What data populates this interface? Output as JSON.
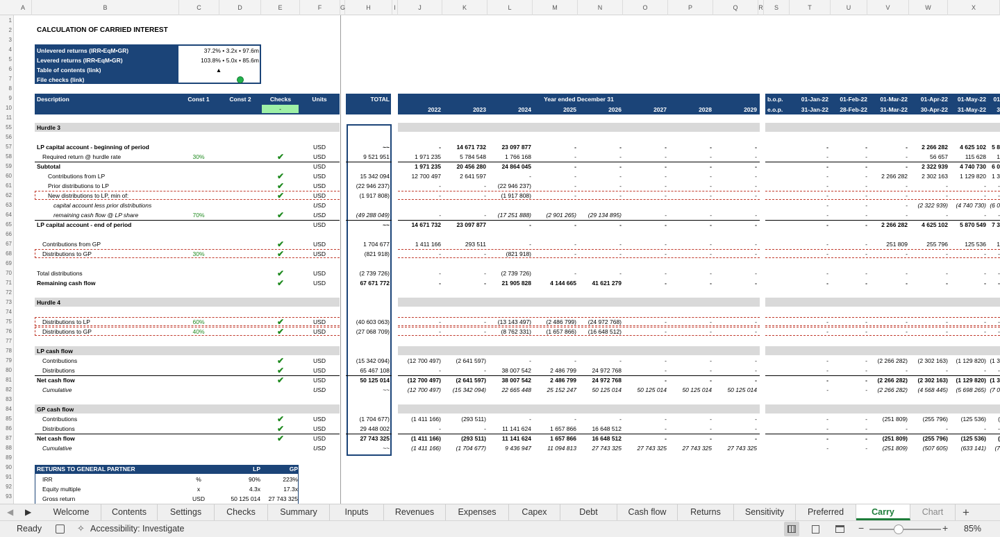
{
  "columns": [
    "A",
    "B",
    "C",
    "D",
    "E",
    "F",
    "G",
    "H",
    "I",
    "J",
    "K",
    "L",
    "M",
    "N",
    "O",
    "P",
    "Q",
    "R",
    "S",
    "T",
    "U",
    "V",
    "W",
    "X"
  ],
  "rows": [
    "1",
    "2",
    "3",
    "4",
    "5",
    "6",
    "7",
    "8",
    "9",
    "10",
    "11",
    "55",
    "56",
    "57",
    "58",
    "59",
    "60",
    "61",
    "62",
    "63",
    "64",
    "65",
    "66",
    "67",
    "68",
    "69",
    "70",
    "71",
    "72",
    "73",
    "74",
    "75",
    "76",
    "77",
    "78",
    "79",
    "80",
    "81",
    "82",
    "83",
    "84",
    "85",
    "86",
    "87",
    "88",
    "89",
    "90",
    "91",
    "92",
    "93"
  ],
  "title": "CALCULATION OF CARRIED INTEREST",
  "summary": {
    "unlevered_label": "Unlevered returns (IRR•EqM•GR)",
    "unlevered_value": "37.2% • 3.2x • 97.6m",
    "levered_label": "Levered returns (IRR•EqM•GR)",
    "levered_value": "103.8% • 5.0x • 85.6m",
    "toc_label": "Table of contents (link)",
    "toc_icon": "▲",
    "checks_label": "File checks (link)"
  },
  "header": {
    "description": "Description",
    "const1": "Const 1",
    "const2": "Const 2",
    "checks": "Checks",
    "checks_value": "-",
    "units": "Units",
    "total": "TOTAL",
    "year_ended": "Year ended December 31",
    "years": [
      "2022",
      "2023",
      "2024",
      "2025",
      "2026",
      "2027",
      "2028",
      "2029"
    ],
    "bop": "b.o.p.",
    "eop": "e.o.p.",
    "months_bop": [
      "01-Jan-22",
      "01-Feb-22",
      "01-Mar-22",
      "01-Apr-22",
      "01-May-22",
      "01"
    ],
    "months_eop": [
      "31-Jan-22",
      "28-Feb-22",
      "31-Mar-22",
      "30-Apr-22",
      "31-May-22",
      "3"
    ]
  },
  "table_rows": [
    {
      "row": "57",
      "label": "LP capital account - beginning of period",
      "bold": true,
      "check": false,
      "units": "USD",
      "total": "~~",
      "years": [
        "-",
        "14 671 732",
        "23 097 877",
        "-",
        "-",
        "-",
        "-",
        "-"
      ],
      "months": [
        "-",
        "-",
        "-",
        "2 266 282",
        "4 625 102",
        "5 8"
      ]
    },
    {
      "row": "58",
      "label": "Required return @ hurdle rate",
      "indent": 1,
      "const1": "30%",
      "check": true,
      "units": "USD",
      "total": "9 521 951",
      "years": [
        "1 971 235",
        "5 784 548",
        "1 766 168",
        "-",
        "-",
        "-",
        "-",
        "-"
      ],
      "months": [
        "-",
        "-",
        "-",
        "56 657",
        "115 628",
        "1"
      ]
    },
    {
      "row": "59",
      "label": "Subtotal",
      "bold": true,
      "units": "USD",
      "total": "",
      "years": [
        "1 971 235",
        "20 456 280",
        "24 864 045",
        "-",
        "-",
        "-",
        "-",
        "-"
      ],
      "months": [
        "-",
        "-",
        "-",
        "2 322 939",
        "4 740 730",
        "6 0"
      ]
    },
    {
      "row": "60",
      "label": "Contributions from LP",
      "indent": 2,
      "check": true,
      "units": "USD",
      "total": "15 342 094",
      "years": [
        "12 700 497",
        "2 641 597",
        "-",
        "-",
        "-",
        "-",
        "-",
        "-"
      ],
      "months": [
        "-",
        "-",
        "2 266 282",
        "2 302 163",
        "1 129 820",
        "1 3"
      ]
    },
    {
      "row": "61",
      "label": "Prior distributions to LP",
      "indent": 2,
      "check": true,
      "units": "USD",
      "total": "(22 946 237)",
      "years": [
        "-",
        "-",
        "(22 946 237)",
        "-",
        "-",
        "-",
        "-",
        "-"
      ],
      "months": [
        "-",
        "-",
        "-",
        "-",
        "-",
        "-"
      ]
    },
    {
      "row": "62",
      "label": "New distributions to LP, min of:",
      "indent": 2,
      "check": true,
      "units": "USD",
      "total": "(1 917 808)",
      "years": [
        "-",
        "-",
        "(1 917 808)",
        "-",
        "-",
        "-",
        "-",
        "-"
      ],
      "months": [
        "-",
        "-",
        "-",
        "-",
        "-",
        "-"
      ]
    },
    {
      "row": "63",
      "label": "capital account less prior distributions",
      "indent": 3,
      "italic": true,
      "units": "USD",
      "total": "",
      "years": [
        "",
        "",
        "",
        "",
        "",
        "",
        "",
        ""
      ],
      "months": [
        "-",
        "-",
        "-",
        "(2 322 939)",
        "(4 740 730)",
        "(6 0"
      ]
    },
    {
      "row": "64",
      "label": "remaining cash flow @ LP share",
      "indent": 3,
      "italic": true,
      "const1": "70%",
      "check": true,
      "units": "USD",
      "total": "(49 288 049)",
      "years": [
        "-",
        "-",
        "(17 251 888)",
        "(2 901 265)",
        "(29 134 895)",
        "-",
        "-",
        "-"
      ],
      "months": [
        "-",
        "-",
        "-",
        "-",
        "-",
        "-"
      ]
    },
    {
      "row": "65",
      "label": "LP capital account - end of period",
      "bold": true,
      "units": "USD",
      "total": "~~",
      "years": [
        "14 671 732",
        "23 097 877",
        "-",
        "-",
        "-",
        "-",
        "-",
        "-"
      ],
      "months": [
        "-",
        "-",
        "2 266 282",
        "4 625 102",
        "5 870 549",
        "7 3"
      ]
    },
    {
      "row": "67",
      "label": "Contributions from GP",
      "indent": 1,
      "check": true,
      "units": "USD",
      "total": "1 704 677",
      "years": [
        "1 411 166",
        "293 511",
        "-",
        "-",
        "-",
        "-",
        "-",
        "-"
      ],
      "months": [
        "-",
        "-",
        "251 809",
        "255 796",
        "125 536",
        "1"
      ]
    },
    {
      "row": "68",
      "label": "Distributions to GP",
      "indent": 1,
      "const1": "30%",
      "check": true,
      "units": "USD",
      "total": "(821 918)",
      "years": [
        "-",
        "-",
        "(821 918)",
        "-",
        "-",
        "-",
        "-",
        "-"
      ],
      "months": [
        "-",
        "-",
        "-",
        "-",
        "-",
        "-"
      ]
    },
    {
      "row": "70",
      "label": "Total distributions",
      "indent": 0,
      "check": true,
      "units": "USD",
      "total": "(2 739 726)",
      "years": [
        "-",
        "-",
        "(2 739 726)",
        "-",
        "-",
        "-",
        "-",
        "-"
      ],
      "months": [
        "-",
        "-",
        "-",
        "-",
        "-",
        "-"
      ]
    },
    {
      "row": "71",
      "label": "Remaining cash flow",
      "bold": true,
      "check": true,
      "units": "USD",
      "total": "67 671 772",
      "years": [
        "-",
        "-",
        "21 905 828",
        "4 144 665",
        "41 621 279",
        "-",
        "-",
        "-"
      ],
      "months": [
        "-",
        "-",
        "-",
        "-",
        "-",
        "-"
      ]
    },
    {
      "row": "75",
      "label": "Distributions to LP",
      "indent": 1,
      "const1": "60%",
      "check": true,
      "units": "USD",
      "total": "(40 603 063)",
      "years": [
        "-",
        "-",
        "(13 143 497)",
        "(2 486 799)",
        "(24 972 768)",
        "-",
        "-",
        "-"
      ],
      "months": [
        "-",
        "-",
        "-",
        "-",
        "-",
        "-"
      ]
    },
    {
      "row": "76",
      "label": "Distributions to GP",
      "indent": 1,
      "const1": "40%",
      "check": true,
      "units": "USD",
      "total": "(27 068 709)",
      "years": [
        "-",
        "-",
        "(8 762 331)",
        "(1 657 866)",
        "(16 648 512)",
        "-",
        "-",
        "-"
      ],
      "months": [
        "-",
        "-",
        "-",
        "-",
        "-",
        "-"
      ]
    },
    {
      "row": "79",
      "label": "Contributions",
      "indent": 1,
      "check": true,
      "units": "USD",
      "total": "(15 342 094)",
      "years": [
        "(12 700 497)",
        "(2 641 597)",
        "-",
        "-",
        "-",
        "-",
        "-",
        "-"
      ],
      "months": [
        "-",
        "-",
        "(2 266 282)",
        "(2 302 163)",
        "(1 129 820)",
        "(1 3"
      ]
    },
    {
      "row": "80",
      "label": "Distributions",
      "indent": 1,
      "check": true,
      "units": "USD",
      "total": "65 467 108",
      "years": [
        "-",
        "-",
        "38 007 542",
        "2 486 799",
        "24 972 768",
        "-",
        "-",
        "-"
      ],
      "months": [
        "-",
        "-",
        "-",
        "-",
        "-",
        "-"
      ]
    },
    {
      "row": "81",
      "label": "Net cash flow",
      "bold": true,
      "check": true,
      "units": "USD",
      "total": "50 125 014",
      "years": [
        "(12 700 497)",
        "(2 641 597)",
        "38 007 542",
        "2 486 799",
        "24 972 768",
        "-",
        "-",
        "-"
      ],
      "months": [
        "-",
        "-",
        "(2 266 282)",
        "(2 302 163)",
        "(1 129 820)",
        "(1 3"
      ]
    },
    {
      "row": "82",
      "label": "Cumulative",
      "indent": 1,
      "italic": true,
      "units": "USD",
      "total": "~~",
      "years": [
        "(12 700 497)",
        "(15 342 094)",
        "22 665 448",
        "25 152 247",
        "50 125 014",
        "50 125 014",
        "50 125 014",
        "50 125 014"
      ],
      "months": [
        "-",
        "-",
        "(2 266 282)",
        "(4 568 445)",
        "(5 698 265)",
        "(7 0"
      ]
    },
    {
      "row": "85",
      "label": "Contributions",
      "indent": 1,
      "check": true,
      "units": "USD",
      "total": "(1 704 677)",
      "years": [
        "(1 411 166)",
        "(293 511)",
        "-",
        "-",
        "-",
        "-",
        "-",
        "-"
      ],
      "months": [
        "-",
        "-",
        "(251 809)",
        "(255 796)",
        "(125 536)",
        "("
      ]
    },
    {
      "row": "86",
      "label": "Distributions",
      "indent": 1,
      "check": true,
      "units": "USD",
      "total": "29 448 002",
      "years": [
        "-",
        "-",
        "11 141 624",
        "1 657 866",
        "16 648 512",
        "-",
        "-",
        "-"
      ],
      "months": [
        "-",
        "-",
        "-",
        "-",
        "-",
        "-"
      ]
    },
    {
      "row": "87",
      "label": "Net cash flow",
      "bold": true,
      "check": true,
      "units": "USD",
      "total": "27 743 325",
      "years": [
        "(1 411 166)",
        "(293 511)",
        "11 141 624",
        "1 657 866",
        "16 648 512",
        "-",
        "-",
        "-"
      ],
      "months": [
        "-",
        "-",
        "(251 809)",
        "(255 796)",
        "(125 536)",
        "("
      ]
    },
    {
      "row": "88",
      "label": "Cumulative",
      "indent": 1,
      "italic": true,
      "units": "USD",
      "total": "~~",
      "years": [
        "(1 411 166)",
        "(1 704 677)",
        "9 436 947",
        "11 094 813",
        "27 743 325",
        "27 743 325",
        "27 743 325",
        "27 743 325"
      ],
      "months": [
        "-",
        "-",
        "(251 809)",
        "(507 605)",
        "(633 141)",
        "(7"
      ]
    }
  ],
  "section_headers": [
    {
      "row": "55",
      "label": "Hurdle 3"
    },
    {
      "row": "73",
      "label": "Hurdle 4"
    },
    {
      "row": "78",
      "label": "LP cash flow"
    },
    {
      "row": "84",
      "label": "GP cash flow"
    }
  ],
  "returns_box": {
    "title": "RETURNS TO GENERAL PARTNER",
    "lp": "LP",
    "gp": "GP",
    "rows": [
      {
        "label": "IRR",
        "units": "%",
        "lp": "90%",
        "gp": "223%"
      },
      {
        "label": "Equity multiple",
        "units": "x",
        "lp": "4.3x",
        "gp": "17.3x"
      },
      {
        "label": "Gross return",
        "units": "USD",
        "lp": "50 125 014",
        "gp": "27 743 325"
      }
    ]
  },
  "tabs": [
    "Welcome",
    "Contents",
    "Settings",
    "Checks",
    "Summary",
    "Inputs",
    "Revenues",
    "Expenses",
    "Capex",
    "Debt",
    "Cash flow",
    "Returns",
    "Sensitivity",
    "Preferred",
    "Carry",
    "Chart"
  ],
  "active_tab": "Carry",
  "status": {
    "ready": "Ready",
    "accessibility": "Accessibility: Investigate",
    "zoom": "85%"
  },
  "colors": {
    "accent_blue": "#1b4478",
    "check_green": "#1f8a1f",
    "active_tab": "#1e7d3a"
  }
}
